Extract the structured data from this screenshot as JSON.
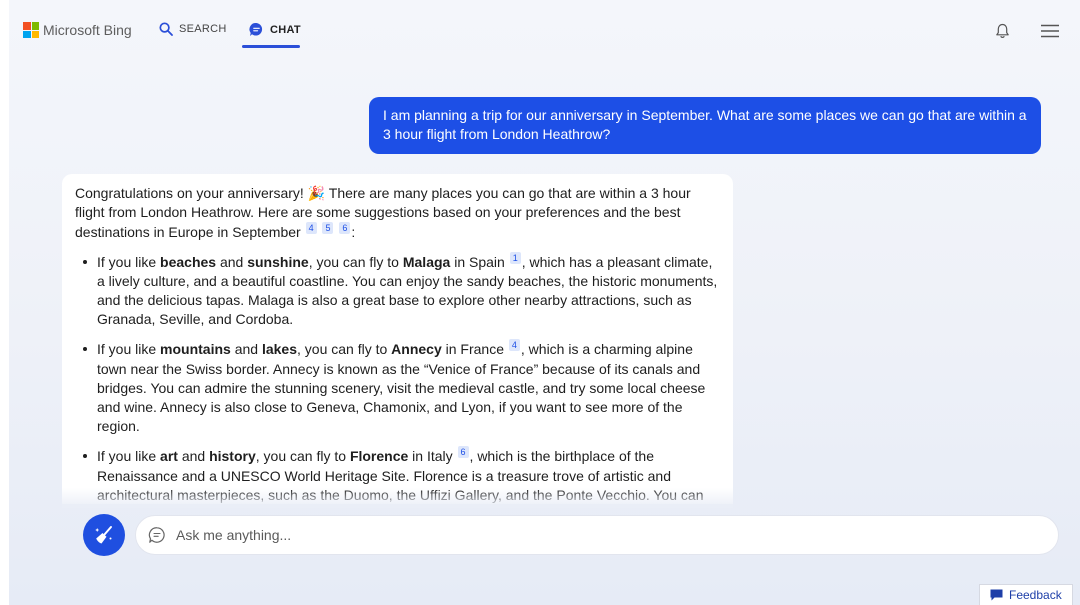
{
  "header": {
    "brand": "Microsoft Bing",
    "brand_colors": [
      "#f25022",
      "#7fba00",
      "#00a4ef",
      "#ffb900"
    ],
    "nav": {
      "search_label": "SEARCH",
      "chat_label": "CHAT",
      "active": "chat"
    },
    "icons": {
      "notifications": "bell-icon",
      "menu": "hamburger-menu-icon"
    }
  },
  "conversation": {
    "user_message": "I am planning a trip for our anniversary in September. What are some places we can go that are within a 3 hour flight from London Heathrow?",
    "bot": {
      "intro_1": "Congratulations on your anniversary! ",
      "intro_emoji": "🎉",
      "intro_2": " There are many places you can go that are within a 3 hour flight from London Heathrow. Here are some suggestions based on your preferences and the best destinations in Europe in September",
      "intro_cites": [
        "4",
        "5",
        "6"
      ],
      "intro_end": ":",
      "items": [
        {
          "t1": "If you like ",
          "b1": "beaches",
          "t2": " and ",
          "b2": "sunshine",
          "t3": ", you can fly to ",
          "b3": "Malaga",
          "t4": " in Spain",
          "cite": "1",
          "t5": ", which has a pleasant climate, a lively culture, and a beautiful coastline. You can enjoy the sandy beaches, the historic monuments, and the delicious tapas. Malaga is also a great base to explore other nearby attractions, such as Granada, Seville, and Cordoba."
        },
        {
          "t1": "If you like ",
          "b1": "mountains",
          "t2": " and ",
          "b2": "lakes",
          "t3": ", you can fly to ",
          "b3": "Annecy",
          "t4": " in France",
          "cite": "4",
          "t5": ", which is a charming alpine town near the Swiss border. Annecy is known as the “Venice of France” because of its canals and bridges. You can admire the stunning scenery, visit the medieval castle, and try some local cheese and wine. Annecy is also close to Geneva, Chamonix, and Lyon, if you want to see more of the region."
        },
        {
          "t1": "If you like ",
          "b1": "art",
          "t2": " and ",
          "b2": "history",
          "t3": ", you can fly to ",
          "b3": "Florence",
          "t4": " in Italy",
          "cite": "6",
          "t5": ", which is the birthplace of the Renaissance and a UNESCO World Heritage Site. Florence is a treasure trove of artistic and architectural masterpieces, such as the Duomo, the Uffizi Gallery, and the Ponte Vecchio. You can also explore the Tuscan countryside, taste the famous gelato, and shop for leather goods."
        }
      ]
    }
  },
  "composer": {
    "placeholder": "Ask me anything...",
    "new_topic_icon": "broom-icon"
  },
  "feedback": {
    "label": "Feedback"
  },
  "colors": {
    "accent": "#1d4fe6",
    "user_bubble": "#1d4fe6",
    "cite_bg": "#dde6fb"
  }
}
